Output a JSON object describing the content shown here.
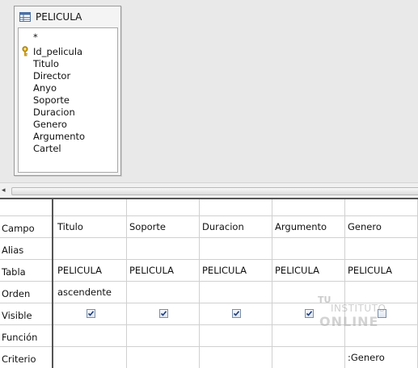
{
  "table_window": {
    "title": "PELICULA",
    "fields": [
      "*",
      "Id_pelicula",
      "Titulo",
      "Director",
      "Anyo",
      "Soporte",
      "Duracion",
      "Genero",
      "Argumento",
      "Cartel"
    ]
  },
  "scrollbar": {
    "left_arrow": "◂"
  },
  "grid": {
    "row_labels": [
      "Campo",
      "Alias",
      "Tabla",
      "Orden",
      "Visible",
      "Función",
      "Criterio"
    ],
    "columns": [
      {
        "campo": "Titulo",
        "alias": "",
        "tabla": "PELICULA",
        "orden": "ascendente",
        "visible": true,
        "funcion": "",
        "criterio": ""
      },
      {
        "campo": "Soporte",
        "alias": "",
        "tabla": "PELICULA",
        "orden": "",
        "visible": true,
        "funcion": "",
        "criterio": ""
      },
      {
        "campo": "Duracion",
        "alias": "",
        "tabla": "PELICULA",
        "orden": "",
        "visible": true,
        "funcion": "",
        "criterio": ""
      },
      {
        "campo": "Argumento",
        "alias": "",
        "tabla": "PELICULA",
        "orden": "",
        "visible": true,
        "funcion": "",
        "criterio": ""
      },
      {
        "campo": "Genero",
        "alias": "",
        "tabla": "PELICULA",
        "orden": "",
        "visible": false,
        "funcion": "",
        "criterio": ":Genero"
      }
    ]
  },
  "watermark": {
    "line1": "TU",
    "line2": "INSTITUTO",
    "line3": "ONLINE"
  }
}
